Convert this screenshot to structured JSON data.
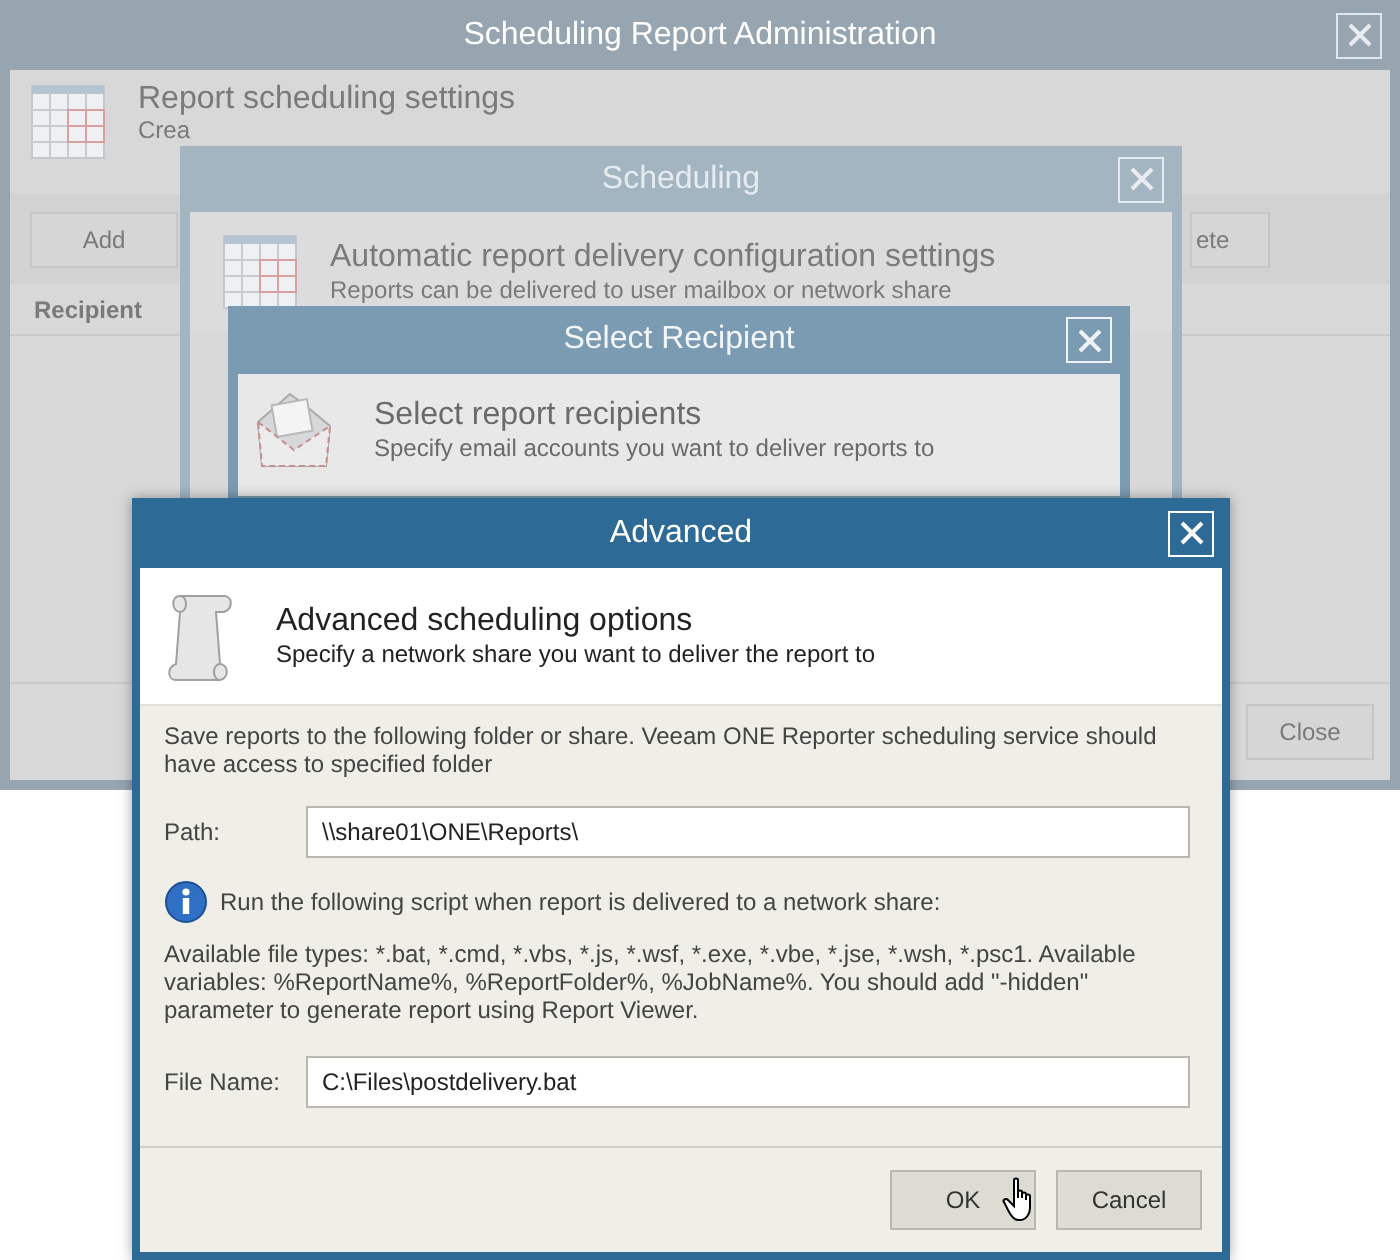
{
  "admin_window": {
    "title": "Scheduling Report Administration",
    "header_title": "Report scheduling settings",
    "header_subtitle": "Crea",
    "toolbar_buttons": [
      "Add",
      "ete"
    ],
    "column_header": "Recipient",
    "footer_buttons": [
      "Close"
    ]
  },
  "scheduling_window": {
    "title": "Scheduling",
    "header_title": "Automatic report delivery configuration settings",
    "header_subtitle": "Reports can be delivered to user mailbox or network share"
  },
  "recipient_window": {
    "title": "Select Recipient",
    "header_title": "Select report recipients",
    "header_subtitle": "Specify email accounts you want to deliver reports to"
  },
  "advanced_window": {
    "title": "Advanced",
    "header_title": "Advanced scheduling options",
    "header_subtitle": "Specify a network share you want to deliver the report to",
    "intro": "Save reports to the following folder or share. Veeam ONE Reporter scheduling service should have access to specified folder",
    "path_label": "Path:",
    "path_value": "\\\\share01\\ONE\\Reports\\",
    "info": "Run the following script when report is delivered to a network share:",
    "note": "Available file types: *.bat, *.cmd, *.vbs, *.js, *.wsf, *.exe, *.vbe, *.jse, *.wsh, *.psc1. Available variables: %ReportName%, %ReportFolder%, %JobName%. You should add \"-hidden\" parameter to generate report using Report Viewer.",
    "file_label": "File Name:",
    "file_value": "C:\\Files\\postdelivery.bat",
    "buttons": [
      "OK",
      "Cancel"
    ]
  }
}
